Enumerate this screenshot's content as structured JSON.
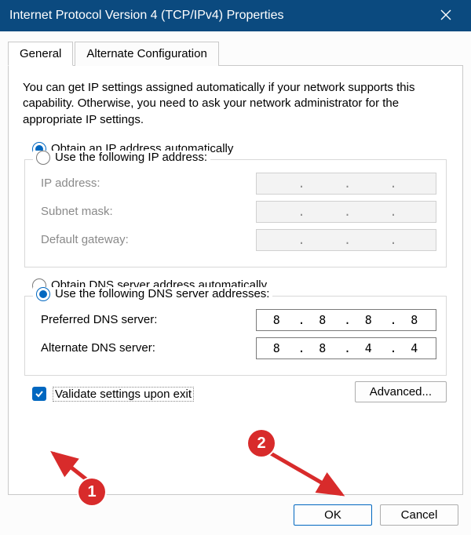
{
  "titlebar": {
    "title": "Internet Protocol Version 4 (TCP/IPv4) Properties"
  },
  "tabs": {
    "general": "General",
    "alternate": "Alternate Configuration"
  },
  "intro": "You can get IP settings assigned automatically if your network supports this capability. Otherwise, you need to ask your network administrator for the appropriate IP settings.",
  "ip_section": {
    "auto_label": "Obtain an IP address automatically",
    "manual_label": "Use the following IP address:",
    "selected": "auto",
    "fields": {
      "ip_address": {
        "label": "IP address:",
        "value": [
          "",
          "",
          "",
          ""
        ]
      },
      "subnet": {
        "label": "Subnet mask:",
        "value": [
          "",
          "",
          "",
          ""
        ]
      },
      "gateway": {
        "label": "Default gateway:",
        "value": [
          "",
          "",
          "",
          ""
        ]
      }
    }
  },
  "dns_section": {
    "auto_label": "Obtain DNS server address automatically",
    "manual_label": "Use the following DNS server addresses:",
    "selected": "manual",
    "fields": {
      "preferred": {
        "label": "Preferred DNS server:",
        "value": [
          "8",
          "8",
          "8",
          "8"
        ]
      },
      "alternate": {
        "label": "Alternate DNS server:",
        "value": [
          "8",
          "8",
          "4",
          "4"
        ]
      }
    }
  },
  "validate": {
    "label": "Validate settings upon exit",
    "checked": true
  },
  "buttons": {
    "advanced": "Advanced...",
    "ok": "OK",
    "cancel": "Cancel"
  },
  "annotations": {
    "badge1": "1",
    "badge2": "2"
  }
}
